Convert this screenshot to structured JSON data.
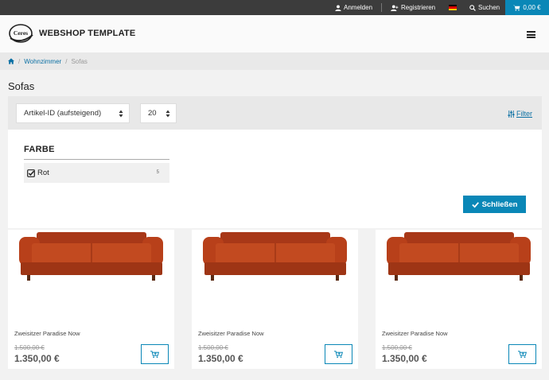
{
  "topbar": {
    "login": "Anmelden",
    "register": "Registrieren",
    "search": "Suchen",
    "cart_total": "0,00 €"
  },
  "header": {
    "brand": "WEBSHOP TEMPLATE",
    "logo_text": "Ceres"
  },
  "breadcrumb": {
    "items": [
      "Wohnzimmer",
      "Sofas"
    ]
  },
  "page": {
    "title": "Sofas"
  },
  "sorting": {
    "sort_value": "Artikel-ID (aufsteigend)",
    "per_page": "20",
    "filter_label": "Filter"
  },
  "filter_panel": {
    "facet_title": "FARBE",
    "facet_items": [
      {
        "label": "Rot",
        "count": "5",
        "checked": true
      }
    ],
    "close_label": "Schließen"
  },
  "products": [
    {
      "name": "Zweisitzer Paradise Now",
      "old_price": "1.500,00 €",
      "price": "1.350,00 €"
    },
    {
      "name": "Zweisitzer Paradise Now",
      "old_price": "1.500,00 €",
      "price": "1.350,00 €"
    },
    {
      "name": "Zweisitzer Paradise Now",
      "old_price": "1.500,00 €",
      "price": "1.350,00 €"
    }
  ],
  "colors": {
    "accent": "#0a87b7",
    "topbar": "#3c3c3c",
    "sofa": "#b8401a"
  }
}
